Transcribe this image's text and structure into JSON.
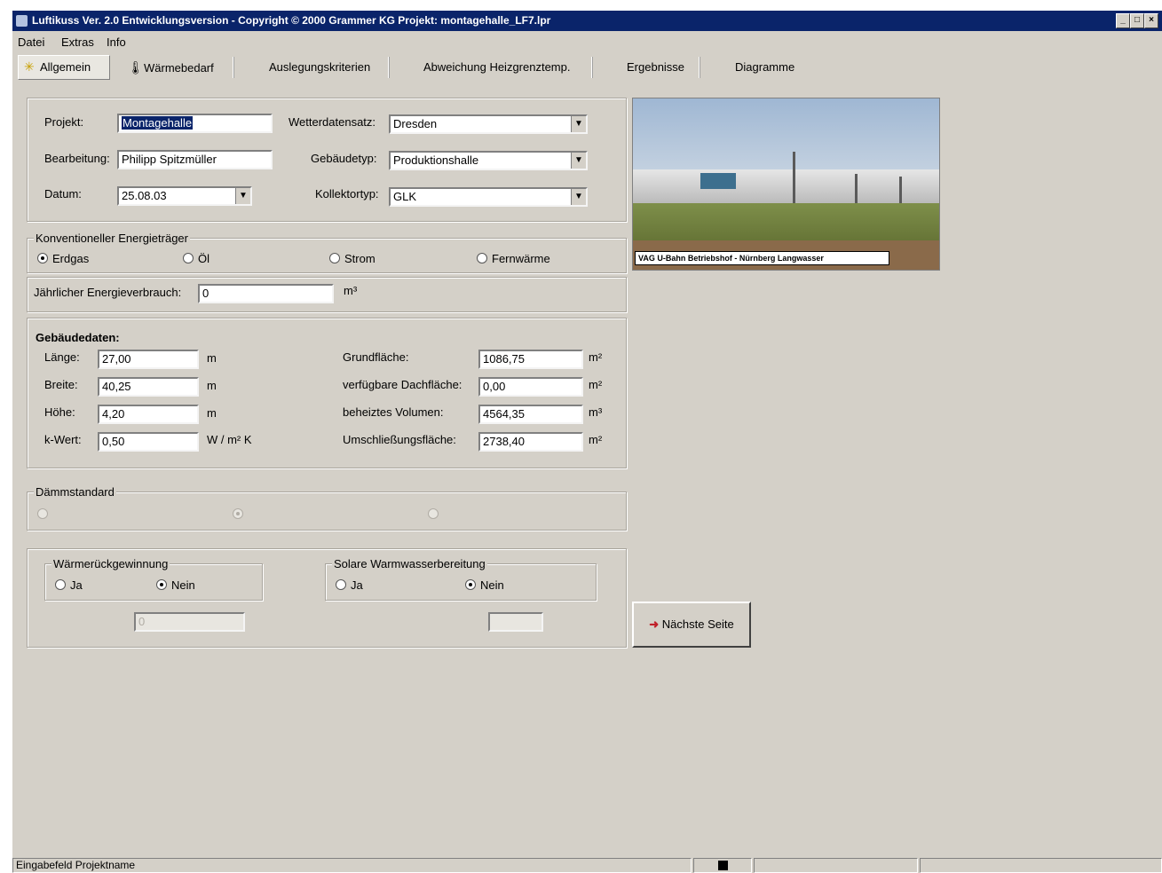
{
  "window": {
    "title": "Luftikuss Ver. 2.0 Entwicklungsversion - Copyright © 2000 Grammer KG Projekt: montagehalle_LF7.lpr"
  },
  "menu": [
    "Datei",
    "Extras",
    "Info"
  ],
  "tabs": [
    "Allgemein",
    "Wärmebedarf",
    "Auslegungskriterien",
    "Abweichung Heizgrenztemp.",
    "Ergebnisse",
    "Diagramme"
  ],
  "projekt": {
    "projekt_label": "Projekt:",
    "projekt_value": "Montagehalle",
    "bearbeitung_label": "Bearbeitung:",
    "bearbeitung_value": "Philipp Spitzmüller",
    "datum_label": "Datum:",
    "datum_value": "25.08.03",
    "wetter_label": "Wetterdatensatz:",
    "wetter_value": "Dresden",
    "gebaeude_label": "Gebäudetyp:",
    "gebaeude_value": "Produktionshalle",
    "kollektor_label": "Kollektortyp:",
    "kollektor_value": "GLK"
  },
  "energie": {
    "legend": "Konventioneller Energieträger",
    "options": [
      "Erdgas",
      "Öl",
      "Strom",
      "Fernwärme"
    ],
    "selected": "Erdgas",
    "verbrauch_label": "Jährlicher Energieverbrauch:",
    "verbrauch_value": "0",
    "verbrauch_unit": "m³"
  },
  "gebaeudedaten": {
    "heading": "Gebäudedaten:",
    "laenge_label": "Länge:",
    "laenge_value": "27,00",
    "laenge_unit": "m",
    "breite_label": "Breite:",
    "breite_value": "40,25",
    "breite_unit": "m",
    "hoehe_label": "Höhe:",
    "hoehe_value": "4,20",
    "hoehe_unit": "m",
    "kwert_label": "k-Wert:",
    "kwert_value": "0,50",
    "kwert_unit": "W / m² K",
    "grund_label": "Grundfläche:",
    "grund_value": "1086,75",
    "grund_unit": "m²",
    "dach_label": "verfügbare Dachfläche:",
    "dach_value": "0,00",
    "dach_unit": "m²",
    "volumen_label": "beheiztes Volumen:",
    "volumen_value": "4564,35",
    "volumen_unit": "m³",
    "umschl_label": "Umschließungsfläche:",
    "umschl_value": "2738,40",
    "umschl_unit": "m²"
  },
  "daemm": {
    "legend": "Dämmstandard"
  },
  "waermerueck": {
    "legend": "Wärmerückgewinnung",
    "ja": "Ja",
    "nein": "Nein",
    "value": "0"
  },
  "solar": {
    "legend": "Solare Warmwasserbereitung",
    "ja": "Ja",
    "nein": "Nein"
  },
  "photo": {
    "caption": "VAG U-Bahn Betriebshof - Nürnberg Langwasser"
  },
  "next_button": "Nächste Seite",
  "status": {
    "hint": "Eingabefeld Projektname"
  },
  "colors": {
    "titlebar": "#0a246a",
    "face": "#d4d0c8",
    "arrow": "#c0202a"
  }
}
